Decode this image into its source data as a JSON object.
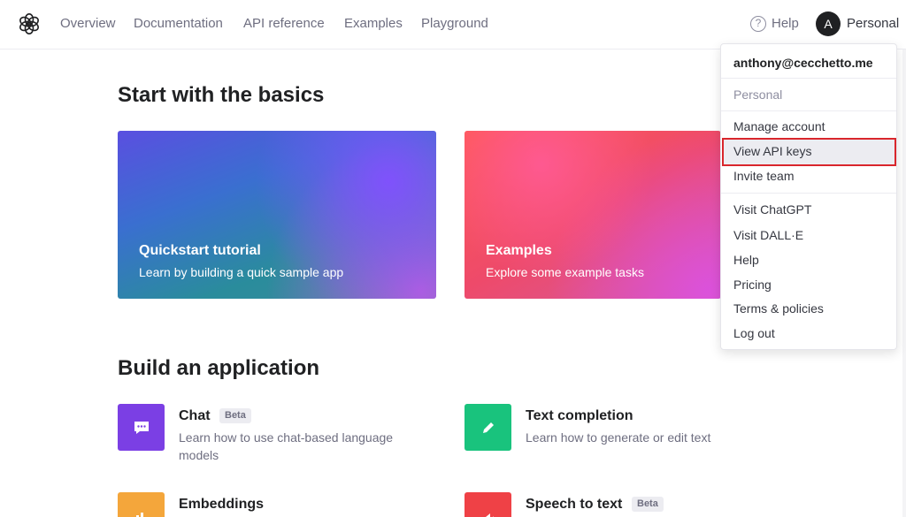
{
  "nav": {
    "links": [
      "Overview",
      "Documentation",
      "API reference",
      "Examples",
      "Playground"
    ],
    "help": "Help",
    "avatar_initial": "A",
    "account": "Personal"
  },
  "basics": {
    "heading": "Start with the basics",
    "cards": [
      {
        "title": "Quickstart tutorial",
        "desc": "Learn by building a quick sample app"
      },
      {
        "title": "Examples",
        "desc": "Explore some example tasks"
      }
    ]
  },
  "build": {
    "heading": "Build an application",
    "apps": [
      {
        "title": "Chat",
        "badge": "Beta",
        "desc": "Learn how to use chat-based language models",
        "icon": "chat-icon",
        "color": "#7b3fe4"
      },
      {
        "title": "Text completion",
        "desc": "Learn how to generate or edit text",
        "icon": "pencil-icon",
        "color": "#19c37d"
      },
      {
        "title": "Embeddings",
        "desc": "",
        "icon": "embeddings-icon",
        "color": "#f4a63b"
      },
      {
        "title": "Speech to text",
        "badge": "Beta",
        "desc": "",
        "icon": "speaker-icon",
        "color": "#ef4146"
      }
    ]
  },
  "menu": {
    "email": "anthony@cecchetto.me",
    "org": "Personal",
    "items": [
      "Manage account",
      "View API keys",
      "Invite team",
      "Visit ChatGPT",
      "Visit DALL·E",
      "Help",
      "Pricing",
      "Terms & policies",
      "Log out"
    ],
    "highlight_color": "#d9262c"
  }
}
